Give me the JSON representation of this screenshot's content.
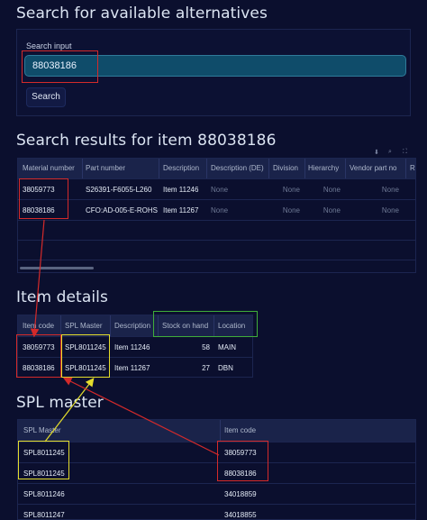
{
  "search": {
    "title": "Search for available alternatives",
    "input_label": "Search input",
    "input_value": "88038186",
    "button_label": "Search"
  },
  "results": {
    "title": "Search results for item 88038186",
    "columns": [
      "Material number",
      "Part number",
      "Description",
      "Description (DE)",
      "Division",
      "Hierarchy",
      "Vendor part no",
      "Re"
    ],
    "rows": [
      [
        "38059773",
        "S26391-F6055-L260",
        "Item 11246",
        "None",
        "None",
        "None",
        "None",
        ""
      ],
      [
        "88038186",
        "CFO:AD-005-E-ROHS",
        "Item 11267",
        "None",
        "None",
        "None",
        "None",
        ""
      ]
    ],
    "toolbar_icons": [
      "download-icon",
      "search-icon",
      "fullscreen-icon"
    ]
  },
  "details": {
    "title": "Item details",
    "columns": [
      "Item code",
      "SPL Master",
      "Description",
      "Stock on hand",
      "Location"
    ],
    "rows": [
      [
        "38059773",
        "SPL8011245",
        "Item 11246",
        "58",
        "MAIN"
      ],
      [
        "88038186",
        "SPL8011245",
        "Item 11267",
        "27",
        "DBN"
      ]
    ]
  },
  "spl": {
    "title": "SPL master",
    "columns": [
      "SPL Master",
      "Item code"
    ],
    "rows": [
      [
        "SPL8011245",
        "38059773"
      ],
      [
        "SPL8011245",
        "88038186"
      ],
      [
        "SPL8011246",
        "34018859"
      ],
      [
        "SPL8011247",
        "34018855"
      ]
    ]
  },
  "colors": {
    "background": "#0b0f2e",
    "input_fill": "#0f4c6a",
    "highlight_red": "#d42a2a",
    "highlight_yellow": "#e4dd2c",
    "highlight_green": "#3fae3a"
  }
}
